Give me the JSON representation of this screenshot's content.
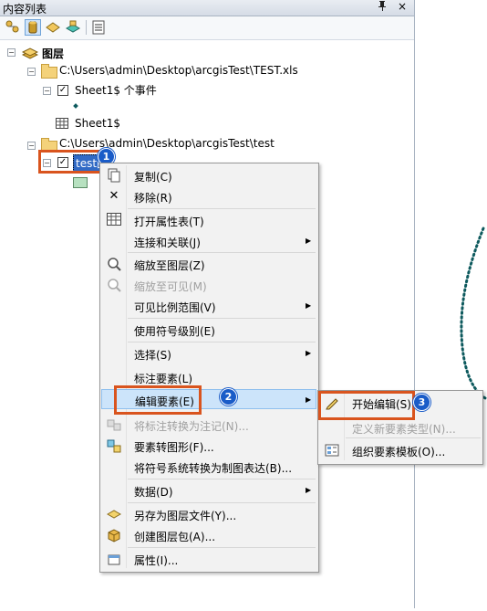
{
  "toc": {
    "title": "内容列表",
    "pin_glyph": "ф",
    "close_glyph": "×",
    "tree": {
      "root_label": "图层",
      "folder1_path": "C:\\Users\\admin\\Desktop\\arcgisTest\\TEST.xls",
      "sheet_events_label": "Sheet1$ 个事件",
      "sheet_table_label": "Sheet1$",
      "folder2_path": "C:\\Users\\admin\\Desktop\\arcgisTest\\test",
      "layer_label": "test图"
    }
  },
  "badges": {
    "one": "1",
    "two": "2",
    "three": "3"
  },
  "context_menu": {
    "items": {
      "copy": "复制(C)",
      "remove": "移除(R)",
      "open_attr": "打开属性表(T)",
      "joins": "连接和关联(J)",
      "zoom_layer": "缩放至图层(Z)",
      "zoom_visible": "缩放至可见(M)",
      "visible_scale": "可见比例范围(V)",
      "symbol_levels": "使用符号级别(E)",
      "selection": "选择(S)",
      "label_features": "标注要素(L)",
      "edit_features": "编辑要素(E)",
      "convert_labels": "将标注转换为注记(N)...",
      "features_to_graphics": "要素转图形(F)...",
      "convert_symbology": "将符号系统转换为制图表达(B)...",
      "data": "数据(D)",
      "save_layer_file": "另存为图层文件(Y)...",
      "create_layer_package": "创建图层包(A)...",
      "properties": "属性(I)..."
    }
  },
  "submenu": {
    "items": {
      "start_editing": "开始编辑(S)",
      "new_feature_type": "定义新要素类型(N)...",
      "organize_templates": "组织要素模板(O)..."
    }
  },
  "colors": {
    "highlight_border": "#d9541e",
    "badge": "#1a5cc8",
    "hover": "#cce4fa",
    "dash_points": "#0e5a5e"
  }
}
